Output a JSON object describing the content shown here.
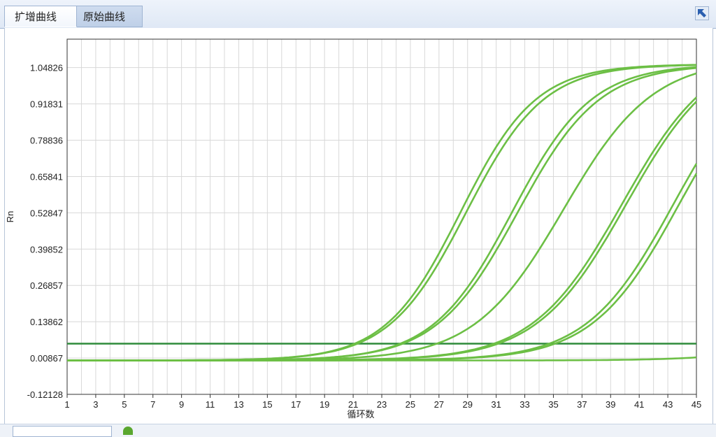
{
  "tabs": [
    {
      "label": "扩增曲线"
    },
    {
      "label": "原始曲线"
    }
  ],
  "icons": {
    "corner": "arrow-up-left-icon"
  },
  "colors": {
    "curve": "#6cbf45",
    "threshold": "#2e8b3a",
    "grid": "#d8d8d8",
    "tab_border": "#9fb4d2"
  },
  "chart_data": {
    "type": "line",
    "xlabel": "循环数",
    "ylabel": "Rn",
    "xlim": [
      1,
      45
    ],
    "ylim": [
      -0.12128,
      1.15
    ],
    "xticks": [
      "1",
      "3",
      "5",
      "7",
      "9",
      "11",
      "13",
      "15",
      "17",
      "19",
      "21",
      "23",
      "25",
      "27",
      "29",
      "31",
      "33",
      "35",
      "37",
      "39",
      "41",
      "43",
      "45"
    ],
    "yticks": [
      "-0.12128",
      "0.00867",
      "0.13862",
      "0.26857",
      "0.39852",
      "0.52847",
      "0.65841",
      "0.78836",
      "0.91831",
      "1.04826"
    ],
    "threshold": 0.06,
    "series": [
      {
        "x0": 28.5,
        "k": 0.38,
        "top": 1.06,
        "base": 0.0
      },
      {
        "x0": 28.9,
        "k": 0.37,
        "top": 1.06,
        "base": 0.0
      },
      {
        "x0": 32.1,
        "k": 0.36,
        "top": 1.06,
        "base": 0.0
      },
      {
        "x0": 32.5,
        "k": 0.35,
        "top": 1.06,
        "base": 0.0
      },
      {
        "x0": 35.7,
        "k": 0.32,
        "top": 1.08,
        "base": 0.0
      },
      {
        "x0": 39.8,
        "k": 0.32,
        "top": 1.12,
        "base": 0.0
      },
      {
        "x0": 40.1,
        "k": 0.32,
        "top": 1.12,
        "base": 0.0
      },
      {
        "x0": 43.4,
        "k": 0.33,
        "top": 1.12,
        "base": 0.0
      },
      {
        "x0": 43.8,
        "k": 0.33,
        "top": 1.12,
        "base": 0.0
      },
      {
        "x0": 60,
        "k": 0.3,
        "top": 1.0,
        "base": 0.0
      }
    ]
  }
}
